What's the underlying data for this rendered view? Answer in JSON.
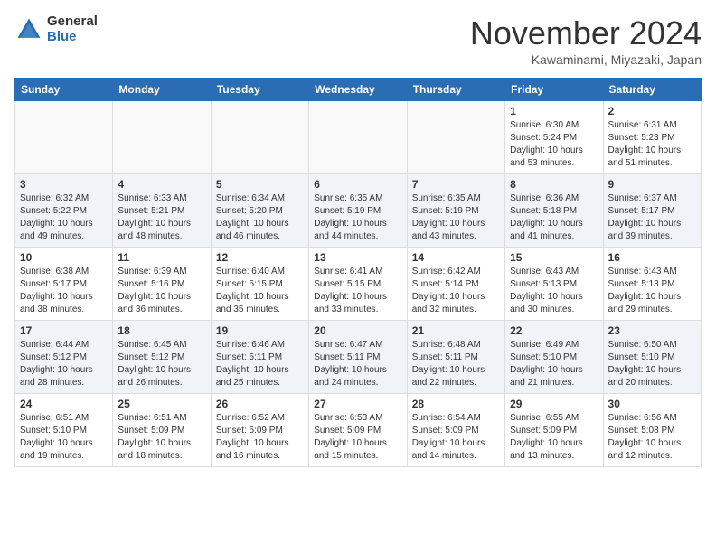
{
  "header": {
    "logo_general": "General",
    "logo_blue": "Blue",
    "month_title": "November 2024",
    "location": "Kawaminami, Miyazaki, Japan"
  },
  "weekdays": [
    "Sunday",
    "Monday",
    "Tuesday",
    "Wednesday",
    "Thursday",
    "Friday",
    "Saturday"
  ],
  "weeks": [
    [
      {
        "day": "",
        "info": ""
      },
      {
        "day": "",
        "info": ""
      },
      {
        "day": "",
        "info": ""
      },
      {
        "day": "",
        "info": ""
      },
      {
        "day": "",
        "info": ""
      },
      {
        "day": "1",
        "info": "Sunrise: 6:30 AM\nSunset: 5:24 PM\nDaylight: 10 hours\nand 53 minutes."
      },
      {
        "day": "2",
        "info": "Sunrise: 6:31 AM\nSunset: 5:23 PM\nDaylight: 10 hours\nand 51 minutes."
      }
    ],
    [
      {
        "day": "3",
        "info": "Sunrise: 6:32 AM\nSunset: 5:22 PM\nDaylight: 10 hours\nand 49 minutes."
      },
      {
        "day": "4",
        "info": "Sunrise: 6:33 AM\nSunset: 5:21 PM\nDaylight: 10 hours\nand 48 minutes."
      },
      {
        "day": "5",
        "info": "Sunrise: 6:34 AM\nSunset: 5:20 PM\nDaylight: 10 hours\nand 46 minutes."
      },
      {
        "day": "6",
        "info": "Sunrise: 6:35 AM\nSunset: 5:19 PM\nDaylight: 10 hours\nand 44 minutes."
      },
      {
        "day": "7",
        "info": "Sunrise: 6:35 AM\nSunset: 5:19 PM\nDaylight: 10 hours\nand 43 minutes."
      },
      {
        "day": "8",
        "info": "Sunrise: 6:36 AM\nSunset: 5:18 PM\nDaylight: 10 hours\nand 41 minutes."
      },
      {
        "day": "9",
        "info": "Sunrise: 6:37 AM\nSunset: 5:17 PM\nDaylight: 10 hours\nand 39 minutes."
      }
    ],
    [
      {
        "day": "10",
        "info": "Sunrise: 6:38 AM\nSunset: 5:17 PM\nDaylight: 10 hours\nand 38 minutes."
      },
      {
        "day": "11",
        "info": "Sunrise: 6:39 AM\nSunset: 5:16 PM\nDaylight: 10 hours\nand 36 minutes."
      },
      {
        "day": "12",
        "info": "Sunrise: 6:40 AM\nSunset: 5:15 PM\nDaylight: 10 hours\nand 35 minutes."
      },
      {
        "day": "13",
        "info": "Sunrise: 6:41 AM\nSunset: 5:15 PM\nDaylight: 10 hours\nand 33 minutes."
      },
      {
        "day": "14",
        "info": "Sunrise: 6:42 AM\nSunset: 5:14 PM\nDaylight: 10 hours\nand 32 minutes."
      },
      {
        "day": "15",
        "info": "Sunrise: 6:43 AM\nSunset: 5:13 PM\nDaylight: 10 hours\nand 30 minutes."
      },
      {
        "day": "16",
        "info": "Sunrise: 6:43 AM\nSunset: 5:13 PM\nDaylight: 10 hours\nand 29 minutes."
      }
    ],
    [
      {
        "day": "17",
        "info": "Sunrise: 6:44 AM\nSunset: 5:12 PM\nDaylight: 10 hours\nand 28 minutes."
      },
      {
        "day": "18",
        "info": "Sunrise: 6:45 AM\nSunset: 5:12 PM\nDaylight: 10 hours\nand 26 minutes."
      },
      {
        "day": "19",
        "info": "Sunrise: 6:46 AM\nSunset: 5:11 PM\nDaylight: 10 hours\nand 25 minutes."
      },
      {
        "day": "20",
        "info": "Sunrise: 6:47 AM\nSunset: 5:11 PM\nDaylight: 10 hours\nand 24 minutes."
      },
      {
        "day": "21",
        "info": "Sunrise: 6:48 AM\nSunset: 5:11 PM\nDaylight: 10 hours\nand 22 minutes."
      },
      {
        "day": "22",
        "info": "Sunrise: 6:49 AM\nSunset: 5:10 PM\nDaylight: 10 hours\nand 21 minutes."
      },
      {
        "day": "23",
        "info": "Sunrise: 6:50 AM\nSunset: 5:10 PM\nDaylight: 10 hours\nand 20 minutes."
      }
    ],
    [
      {
        "day": "24",
        "info": "Sunrise: 6:51 AM\nSunset: 5:10 PM\nDaylight: 10 hours\nand 19 minutes."
      },
      {
        "day": "25",
        "info": "Sunrise: 6:51 AM\nSunset: 5:09 PM\nDaylight: 10 hours\nand 18 minutes."
      },
      {
        "day": "26",
        "info": "Sunrise: 6:52 AM\nSunset: 5:09 PM\nDaylight: 10 hours\nand 16 minutes."
      },
      {
        "day": "27",
        "info": "Sunrise: 6:53 AM\nSunset: 5:09 PM\nDaylight: 10 hours\nand 15 minutes."
      },
      {
        "day": "28",
        "info": "Sunrise: 6:54 AM\nSunset: 5:09 PM\nDaylight: 10 hours\nand 14 minutes."
      },
      {
        "day": "29",
        "info": "Sunrise: 6:55 AM\nSunset: 5:09 PM\nDaylight: 10 hours\nand 13 minutes."
      },
      {
        "day": "30",
        "info": "Sunrise: 6:56 AM\nSunset: 5:08 PM\nDaylight: 10 hours\nand 12 minutes."
      }
    ]
  ]
}
